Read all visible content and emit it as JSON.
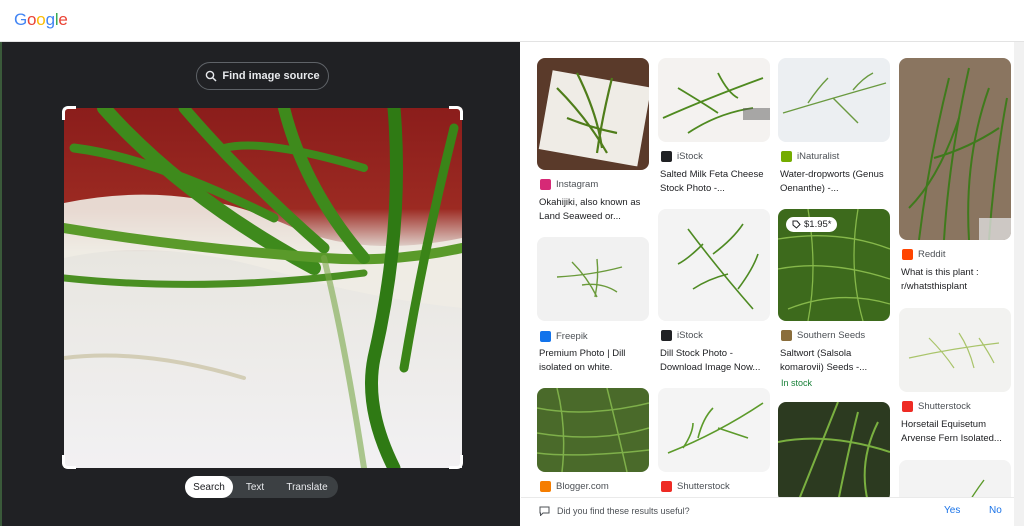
{
  "header": {
    "logo_text": "Google"
  },
  "lens": {
    "find_source_label": "Find image source",
    "modes": [
      {
        "label": "Search",
        "active": true
      },
      {
        "label": "Text",
        "active": false
      },
      {
        "label": "Translate",
        "active": false
      }
    ]
  },
  "results": [
    {
      "source": "Instagram",
      "title": "Okahijiki, also known as Land Seaweed or...",
      "favicon_color": "#d62976"
    },
    {
      "source": "iStock",
      "title": "Salted Milk Feta Cheese Stock Photo -...",
      "favicon_color": "#202124"
    },
    {
      "source": "iNaturalist",
      "title": "Water-dropworts (Genus Oenanthe) -...",
      "favicon_color": "#74ac00"
    },
    {
      "source": "Reddit",
      "title": "What is this plant : r/whatsthisplant",
      "favicon_color": "#ff4500"
    },
    {
      "source": "Freepik",
      "title": "Premium Photo | Dill isolated on white.",
      "favicon_color": "#1273eb"
    },
    {
      "source": "iStock",
      "title": "Dill Stock Photo - Download Image Now...",
      "favicon_color": "#202124"
    },
    {
      "source": "Southern Seeds",
      "title": "Saltwort (Salsola komarovii) Seeds -...",
      "favicon_color": "#8a6d3b",
      "price": "$1.95*",
      "stock": "In stock"
    },
    {
      "source": "Shutterstock",
      "title": "Horsetail Equisetum Arvense Fern Isolated...",
      "favicon_color": "#ee2b24"
    },
    {
      "source": "Blogger.com",
      "title": "",
      "favicon_color": "#f57d00"
    },
    {
      "source": "Shutterstock",
      "title": "",
      "favicon_color": "#ee2b24"
    }
  ],
  "feedback": {
    "question": "Did you find these results useful?",
    "yes": "Yes",
    "no": "No"
  }
}
